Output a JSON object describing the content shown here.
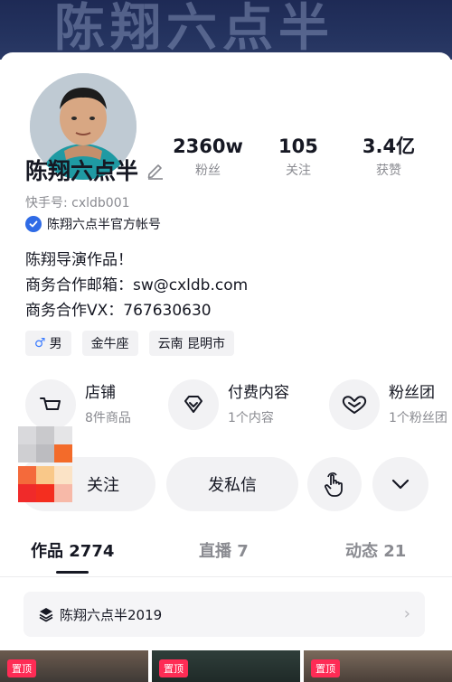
{
  "banner": {
    "text": "陈翔六点半"
  },
  "profile": {
    "name": "陈翔六点半",
    "id_line": "快手号: cxldb001",
    "verified_text": "陈翔六点半官方帐号"
  },
  "stats": [
    {
      "value": "2360w",
      "label": "粉丝"
    },
    {
      "value": "105",
      "label": "关注"
    },
    {
      "value": "3.4亿",
      "label": "获赞"
    }
  ],
  "bio": {
    "line1": "陈翔导演作品！",
    "line2": "商务合作邮箱：sw@cxldb.com",
    "line3": "商务合作VX：767630630"
  },
  "tags": {
    "gender_icon": "♂",
    "gender": "男",
    "zodiac": "金牛座",
    "location": "云南 昆明市"
  },
  "services": [
    {
      "title": "店铺",
      "sub": "8件商品",
      "icon": "cart-icon"
    },
    {
      "title": "付费内容",
      "sub": "1个内容",
      "icon": "diamond-icon"
    },
    {
      "title": "粉丝团",
      "sub": "1个粉丝团",
      "icon": "heart-icon"
    }
  ],
  "actions": {
    "follow": "关注",
    "message": "发私信"
  },
  "tabs": [
    {
      "label": "作品 2774"
    },
    {
      "label": "直播 7"
    },
    {
      "label": "动态 21"
    }
  ],
  "collection": {
    "label": "陈翔六点半2019"
  },
  "pinned_label": "置顶",
  "colors": {
    "accent": "#fe2c55",
    "verified": "#2f6be6",
    "text": "#161823",
    "muted": "#8a8b91"
  }
}
